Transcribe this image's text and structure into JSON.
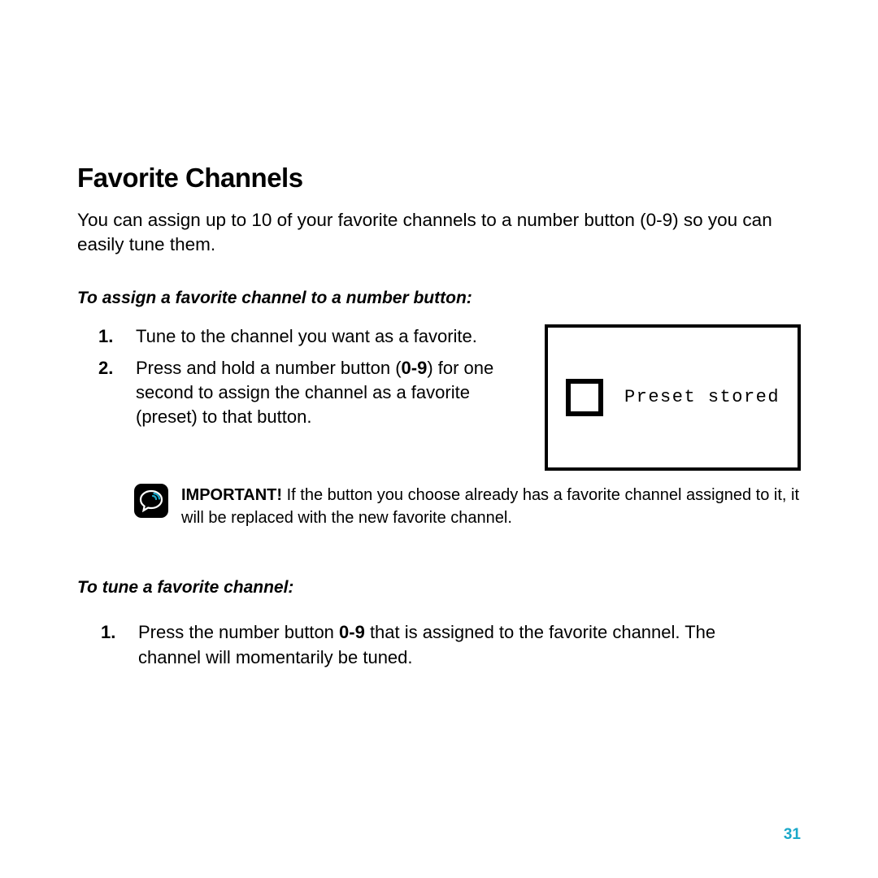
{
  "heading": "Favorite Channels",
  "intro": "You can assign up to 10 of your favorite channels to a number button (0-9) so you can easily tune them.",
  "assign": {
    "subheading": "To assign a favorite channel to a number button:",
    "steps": [
      {
        "num": "1.",
        "text": "Tune to the channel you want as a favorite."
      },
      {
        "num": "2.",
        "pre": "Press and hold a number button (",
        "bold": "0-9",
        "post": ") for one second to assign the channel as a favorite (preset) to that button."
      }
    ],
    "display_text": "Preset stored"
  },
  "important": {
    "label": "IMPORTANT!",
    "text": " If the button you choose already has a favorite channel assigned to it, it will be replaced with the new favorite channel."
  },
  "tune": {
    "subheading": "To tune a favorite channel:",
    "steps": [
      {
        "num": "1.",
        "pre": "Press the number button ",
        "bold": "0-9",
        "post": " that is assigned to the favorite channel. The channel will momentarily be tuned."
      }
    ]
  },
  "page_number": "31"
}
